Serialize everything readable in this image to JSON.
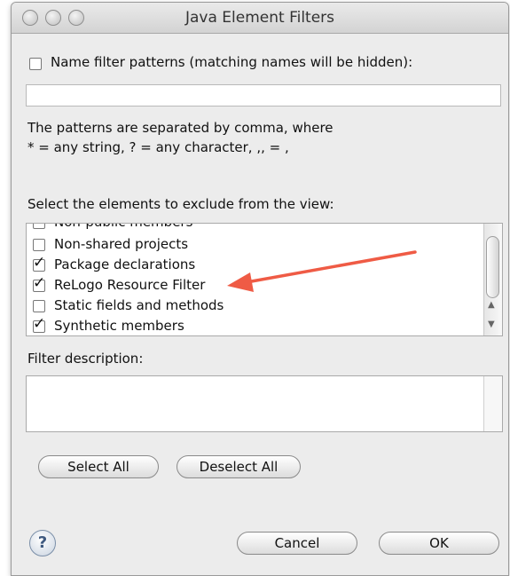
{
  "window": {
    "title": "Java Element Filters"
  },
  "name_filter": {
    "checked": false,
    "label": "Name filter patterns (matching names will be hidden):",
    "value": ""
  },
  "patterns_note": {
    "line1": "The patterns are separated by comma, where",
    "line2": "* = any string, ? = any character, ,, = ,"
  },
  "elements": {
    "label": "Select the elements to exclude from the view:",
    "items": [
      {
        "label": "Non-public members",
        "checked": false
      },
      {
        "label": "Non-shared projects",
        "checked": false
      },
      {
        "label": "Package declarations",
        "checked": true
      },
      {
        "label": "ReLogo Resource Filter",
        "checked": true
      },
      {
        "label": "Static fields and methods",
        "checked": false
      },
      {
        "label": "Synthetic members",
        "checked": true
      }
    ]
  },
  "description": {
    "label": "Filter description:",
    "value": ""
  },
  "buttons": {
    "select_all": "Select All",
    "deselect_all": "Deselect All",
    "cancel": "Cancel",
    "ok": "OK",
    "help": "?"
  },
  "annotation": {
    "color": "#ef5b45"
  },
  "icons": {
    "check": "✓",
    "scroll_up": "▲",
    "scroll_down": "▼"
  }
}
